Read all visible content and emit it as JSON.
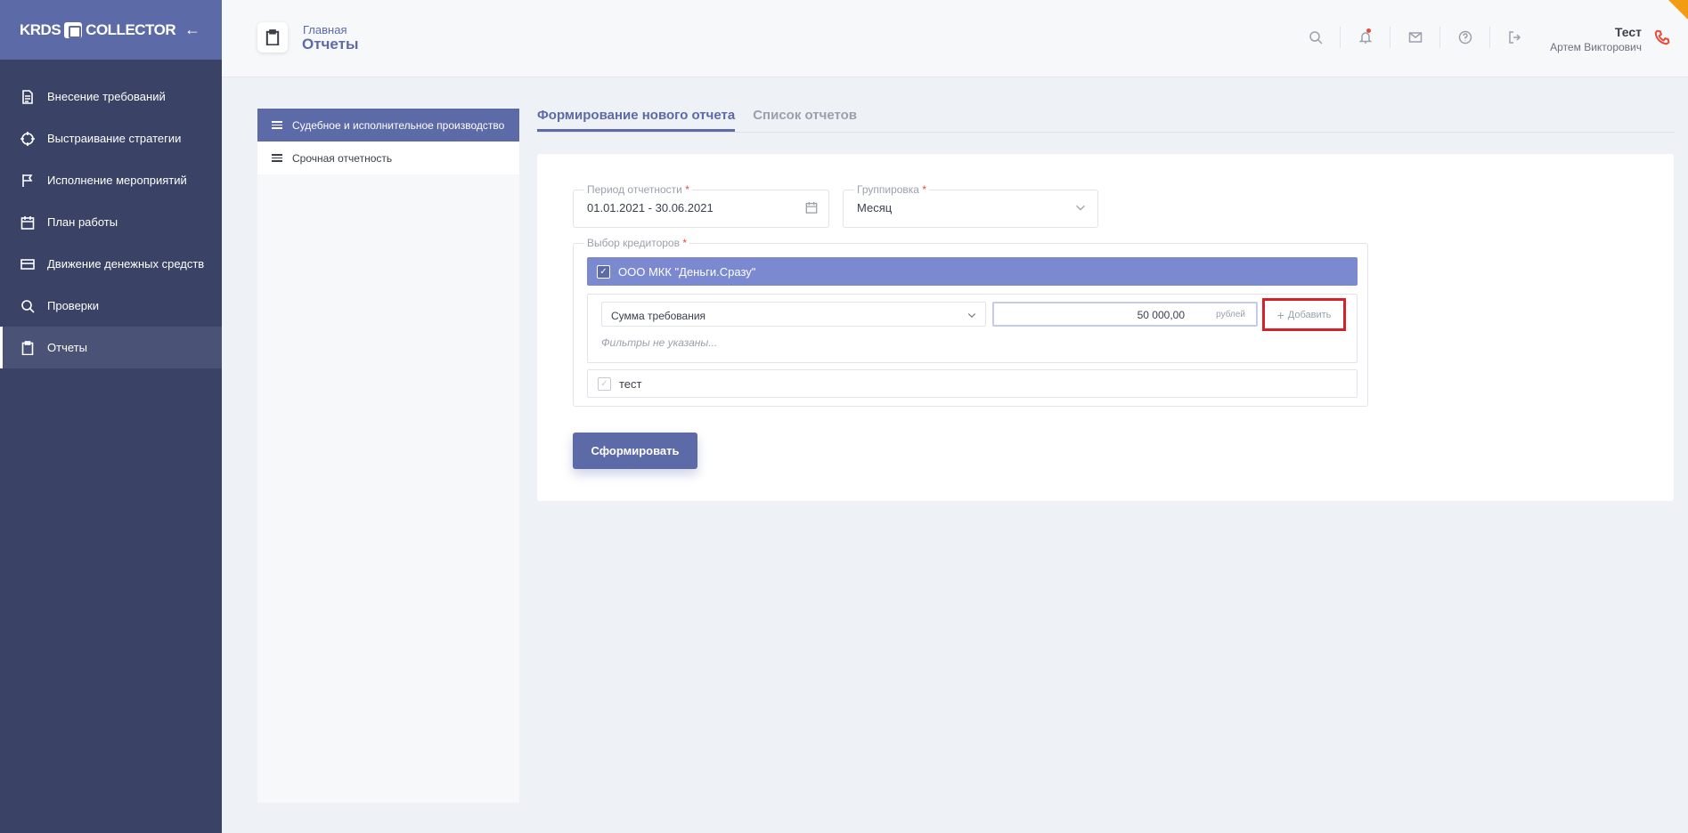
{
  "sidebar": {
    "logo": "KRDS COLLECTOR",
    "items": [
      {
        "label": "Внесение требований",
        "icon": "document-icon"
      },
      {
        "label": "Выстраивание стратегии",
        "icon": "crosshair-icon"
      },
      {
        "label": "Исполнение мероприятий",
        "icon": "flag-icon"
      },
      {
        "label": "План работы",
        "icon": "calendar-icon"
      },
      {
        "label": "Движение денежных средств",
        "icon": "credit-card-icon"
      },
      {
        "label": "Проверки",
        "icon": "search-icon"
      },
      {
        "label": "Отчеты",
        "icon": "clipboard-icon",
        "active": true
      }
    ]
  },
  "header": {
    "breadcrumb": "Главная",
    "title": "Отчеты",
    "user_name": "Тест",
    "user_full": "Артем Викторович"
  },
  "reports": [
    {
      "label": "Судебное и исполнительное производство",
      "active": true
    },
    {
      "label": "Срочная отчетность",
      "active": false
    }
  ],
  "tabs": [
    {
      "label": "Формирование нового отчета",
      "active": true
    },
    {
      "label": "Список отчетов",
      "active": false
    }
  ],
  "form": {
    "period_label": "Период отчетности",
    "period_value": "01.01.2021 - 30.06.2021",
    "group_label": "Группировка",
    "group_value": "Месяц",
    "creditors_label": "Выбор кредиторов",
    "creditor1": "ООО МКК \"Деньги.Сразу\"",
    "filter_field": "Сумма требования",
    "amount": "50 000,00",
    "unit": "рублей",
    "add_label": "Добавить",
    "no_filters": "Фильтры не указаны...",
    "creditor2": "тест",
    "submit_label": "Сформировать"
  },
  "colors": {
    "accent": "#5c6aa8",
    "sidebar": "#3a4265",
    "highlight": "#d8202b"
  }
}
